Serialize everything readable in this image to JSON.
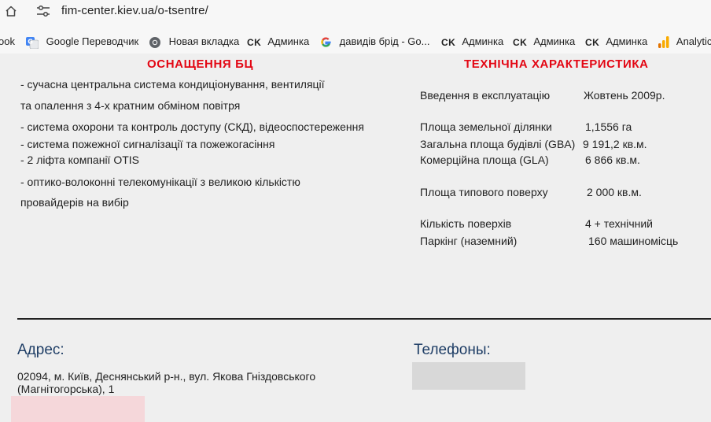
{
  "browser": {
    "url": "fim-center.kiev.ua/o-tsentre/",
    "bookmarks": [
      {
        "label": "ook",
        "icon": "partial-bookmark-icon"
      },
      {
        "label": "Google Переводчик",
        "icon": "google-translate-icon"
      },
      {
        "label": "Новая вкладка",
        "icon": "chrome-icon"
      },
      {
        "label": "Админка",
        "icon": "ck-icon",
        "badge": "CK"
      },
      {
        "label": "давидів брід - Go...",
        "icon": "google-g-icon"
      },
      {
        "label": "Админка",
        "icon": "ck-icon",
        "badge": "CK"
      },
      {
        "label": "Админка",
        "icon": "ck-icon",
        "badge": "CK"
      },
      {
        "label": "Админка",
        "icon": "ck-icon",
        "badge": "CK"
      },
      {
        "label": "Analytic",
        "icon": "analytics-icon"
      }
    ]
  },
  "equipment": {
    "heading": "ОСНАЩЕННЯ БЦ",
    "lines": [
      "- сучасна центральна система кондиціонування, вентиляції",
      "та опалення з 4-х кратним обміном повітря",
      "- система охорони та контроль доступу (СКД), відеоспостереження",
      "- система пожежної сигналізації та пожежогасіння",
      "- 2 ліфта компанії OTIS",
      "- оптико-волоконні телекомунікації з великою кількістю",
      "провайдерів на вибір"
    ]
  },
  "specs": {
    "heading": "ТЕХНІЧНА ХАРАКТЕРИСТИКА",
    "rows": [
      {
        "label": "Введення в експлуатацію",
        "value": "Жовтень 2009р."
      },
      {
        "label": "Площа земельної ділянки",
        "value": "1,1556 га"
      },
      {
        "label": "Загальна площа будівлі (GBA)",
        "value": "9 191,2 кв.м."
      },
      {
        "label": "Комерційна площа (GLA)",
        "value": "6 866 кв.м."
      },
      {
        "label": "Площа типового поверху",
        "value": "2 000 кв.м."
      },
      {
        "label": "Кількість поверхів",
        "value": "4 + технічний"
      },
      {
        "label": "Паркінг (наземний)",
        "value": "160 машиномісць"
      }
    ]
  },
  "footer": {
    "address_label": "Адрес:",
    "address_line1": "02094, м. Київ, Деснянський р-н., вул. Якова Гніздовського",
    "address_line2": "(Магнітогорська), 1",
    "phones_label": "Телефоны:"
  },
  "colors": {
    "heading_red": "#e30613",
    "label_blue": "#1f3e66",
    "background": "#efefef"
  }
}
